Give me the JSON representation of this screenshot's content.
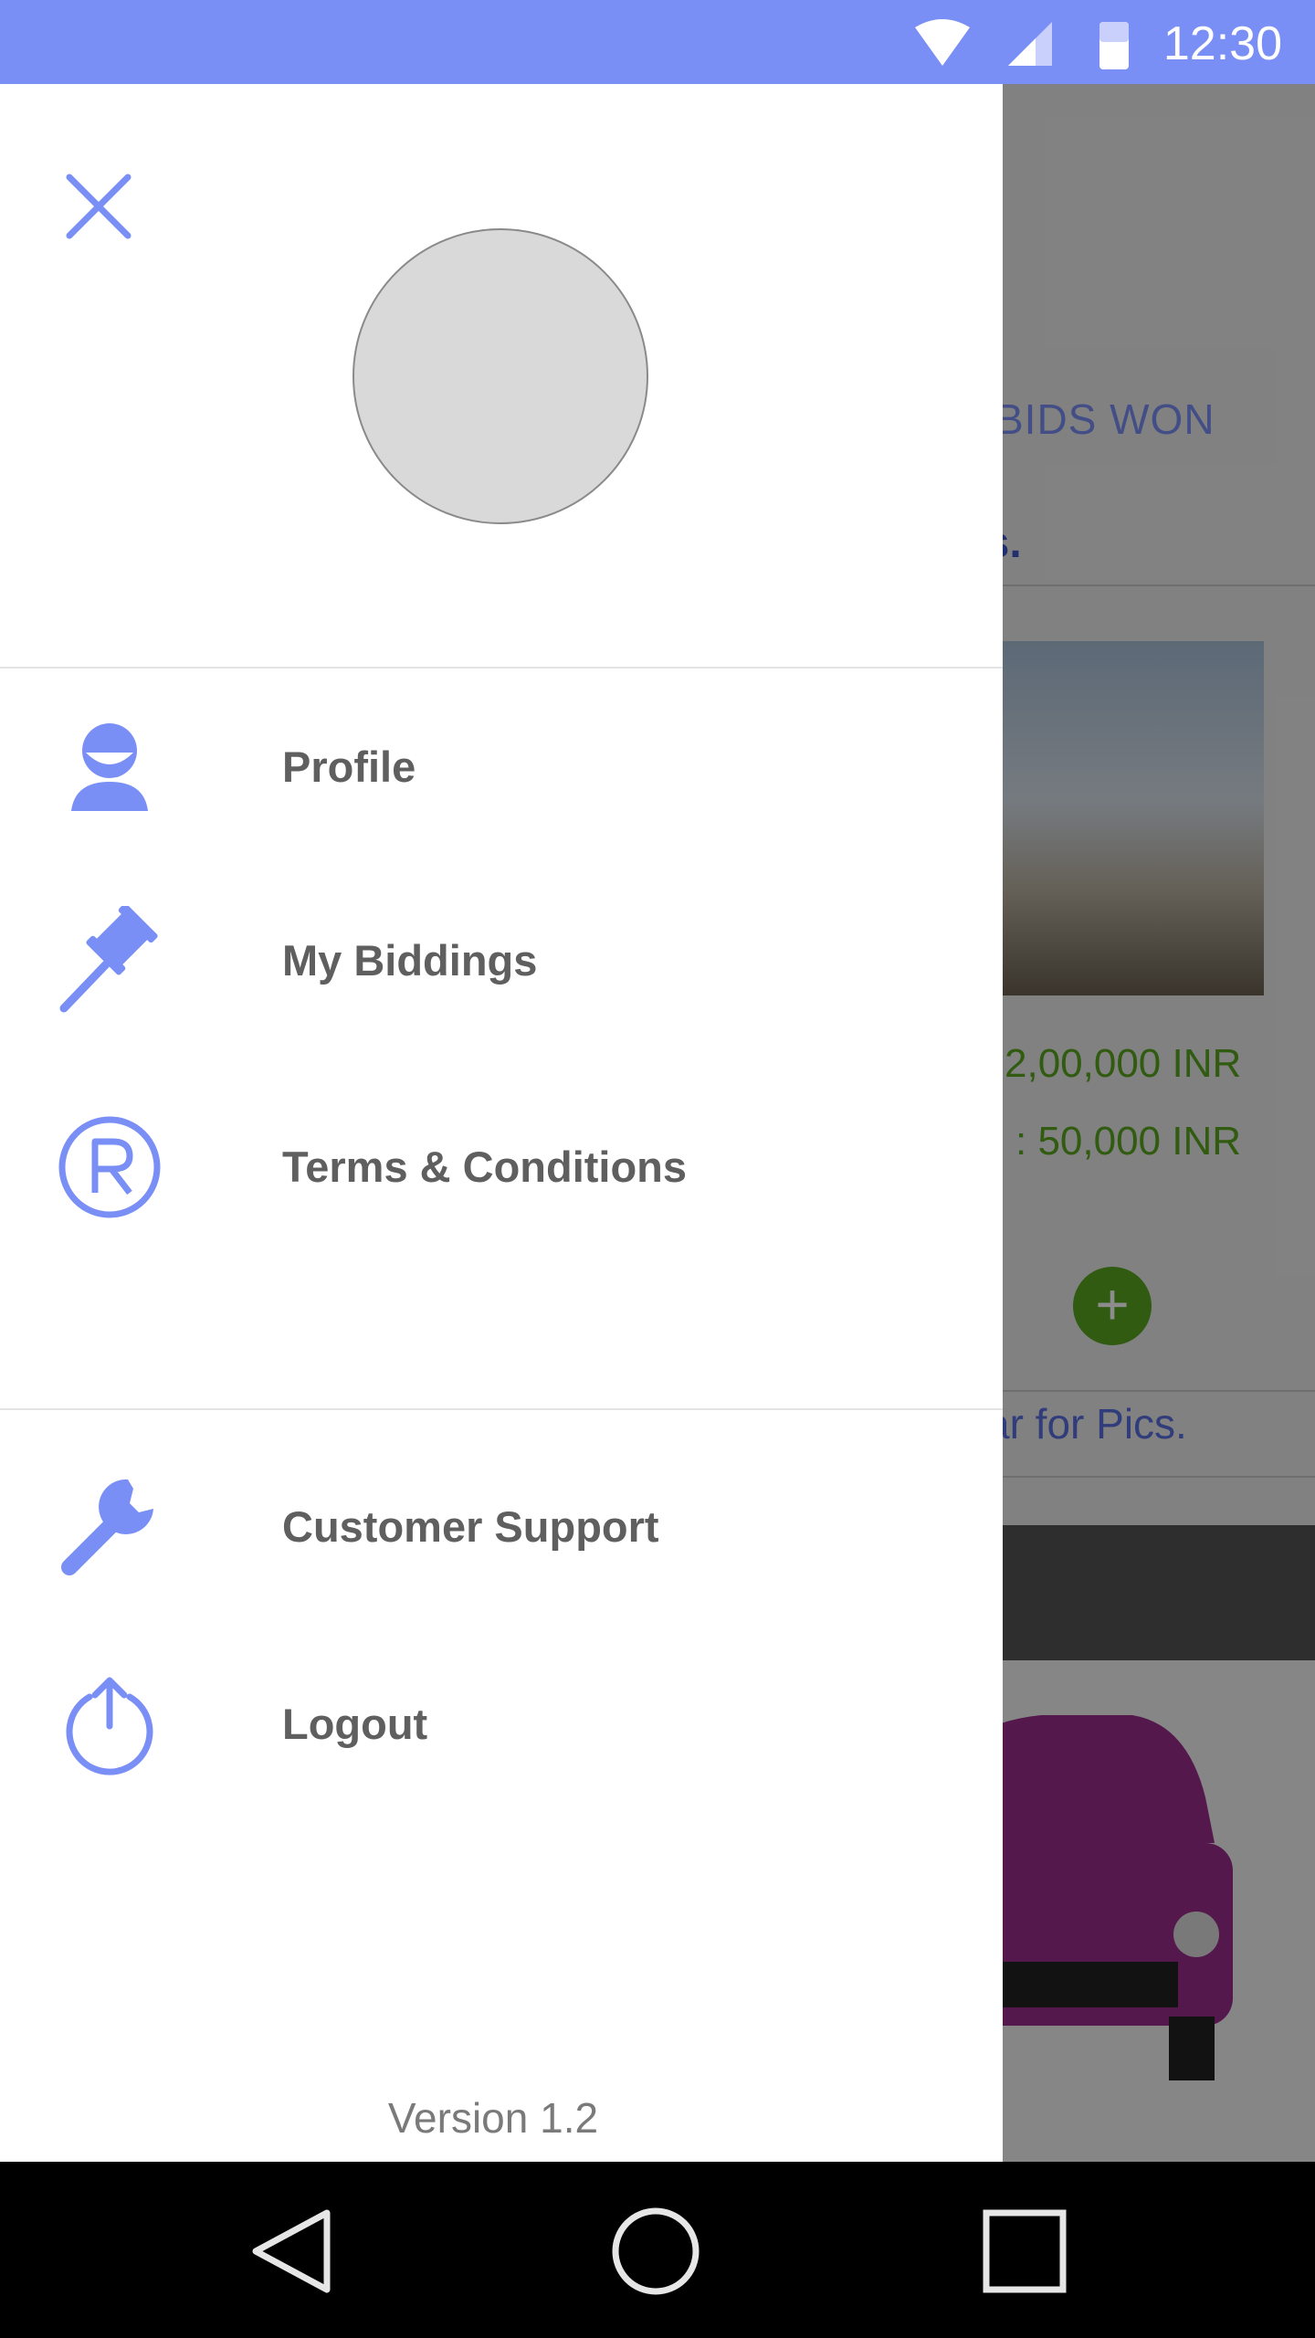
{
  "status_bar": {
    "time": "12:30"
  },
  "background": {
    "tab_label": "BIDS WON",
    "heading_fragment": "rs.",
    "price_1": "2,00,000 INR",
    "price_2": ": 50,000 INR",
    "pics_text": "ar for Pics."
  },
  "drawer": {
    "menu": [
      {
        "label": "Profile",
        "icon": "person-icon"
      },
      {
        "label": "My Biddings",
        "icon": "gavel-icon"
      },
      {
        "label": "Terms & Conditions",
        "icon": "registered-icon"
      }
    ],
    "secondary_menu": [
      {
        "label": "Customer Support",
        "icon": "wrench-icon"
      },
      {
        "label": "Logout",
        "icon": "power-icon"
      }
    ],
    "version": "Version 1.2"
  },
  "colors": {
    "accent": "#7a8ff5",
    "text": "#5f5f5f",
    "price_green": "#5aa61e"
  }
}
